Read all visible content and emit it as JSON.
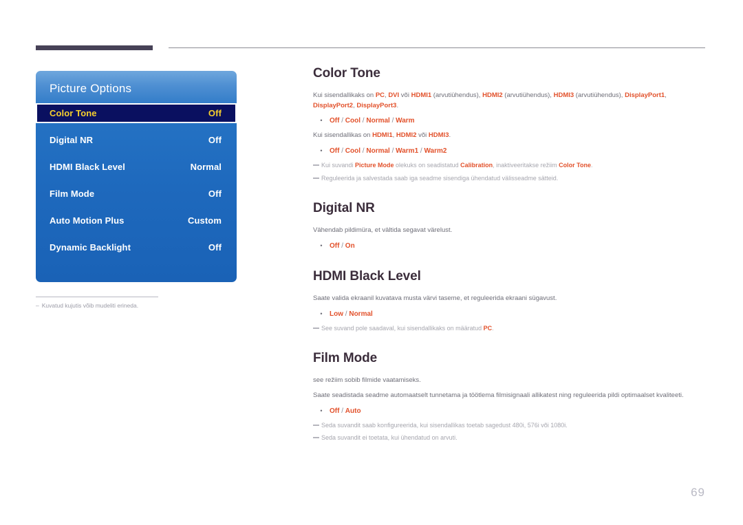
{
  "page": {
    "number": "69"
  },
  "osd": {
    "title": "Picture Options",
    "rows": [
      {
        "label": "Color Tone",
        "value": "Off",
        "selected": true
      },
      {
        "label": "Digital NR",
        "value": "Off",
        "selected": false
      },
      {
        "label": "HDMI Black Level",
        "value": "Normal",
        "selected": false
      },
      {
        "label": "Film Mode",
        "value": "Off",
        "selected": false
      },
      {
        "label": "Auto Motion Plus",
        "value": "Custom",
        "selected": false
      },
      {
        "label": "Dynamic Backlight",
        "value": "Off",
        "selected": false
      }
    ],
    "note_dash": "–",
    "note": "Kuvatud kujutis võib mudeliti erineda."
  },
  "sections": {
    "color_tone": {
      "title": "Color Tone",
      "para1_a": "Kui sisendallikaks on ",
      "para1_pc": "PC",
      "para1_b": ", ",
      "para1_dvi": "DVI",
      "para1_c": " või ",
      "para1_hdmi1": "HDMI1",
      "para1_d": " (arvutiühendus), ",
      "para1_hdmi2": "HDMI2",
      "para1_e": " (arvutiühendus), ",
      "para1_hdmi3": "HDMI3",
      "para1_f": " (arvutiühendus), ",
      "para1_dp1": "DisplayPort1",
      "para1_g": ", ",
      "para1_dp2": "DisplayPort2",
      "para1_h": ", ",
      "para1_dp3": "DisplayPort3",
      "para1_i": ".",
      "bullet1": "Off / Cool / Normal / Warm",
      "para2_a": "Kui sisendallikas on ",
      "para2_hdmi1": "HDMI1",
      "para2_b": ", ",
      "para2_hdmi2": "HDMI2",
      "para2_c": " või ",
      "para2_hdmi3": "HDMI3",
      "para2_d": ".",
      "bullet2": "Off / Cool / Normal / Warm1 / Warm2",
      "note1_a": "Kui suvandi ",
      "note1_picture_mode": "Picture Mode",
      "note1_b": " olekuks on seadistatud ",
      "note1_calibration": "Calibration",
      "note1_c": ", inaktiveeritakse režiim ",
      "note1_color_tone": "Color Tone",
      "note1_d": ".",
      "note2": "Reguleerida ja salvestada saab iga seadme sisendiga ühendatud välisseadme sätteid."
    },
    "digital_nr": {
      "title": "Digital NR",
      "para1": "Vähendab pildimüra, et vältida segavat värelust.",
      "bullet1": "Off / On"
    },
    "hdmi_black_level": {
      "title": "HDMI Black Level",
      "para1": "Saate valida ekraanil kuvatava musta värvi taseme, et reguleerida ekraani sügavust.",
      "bullet1": "Low / Normal",
      "note1_a": "See suvand pole saadaval, kui sisendallikaks on määratud ",
      "note1_pc": "PC",
      "note1_b": "."
    },
    "film_mode": {
      "title": "Film Mode",
      "para1": "see režiim sobib filmide vaatamiseks.",
      "para2": "Saate seadistada seadme automaatselt tunnetama ja töötlema filmisignaali allikatest ning reguleerida pildi optimaalset kvaliteeti.",
      "bullet1": "Off / Auto",
      "note1": "Seda suvandit saab konfigureerida, kui sisendallikas toetab sagedust 480i, 576i või 1080i.",
      "note2": "Seda suvandit ei toetata, kui ühendatud on arvuti."
    }
  },
  "colors": {
    "accent_orange": "#e2512b",
    "heading": "#3b2d3b",
    "osd_blue": "#1e69bd",
    "osd_selected_bg": "#0a1060",
    "osd_selected_text": "#f6cf2e",
    "body_text": "#6e6e78",
    "note_text": "#a6a6ae"
  }
}
